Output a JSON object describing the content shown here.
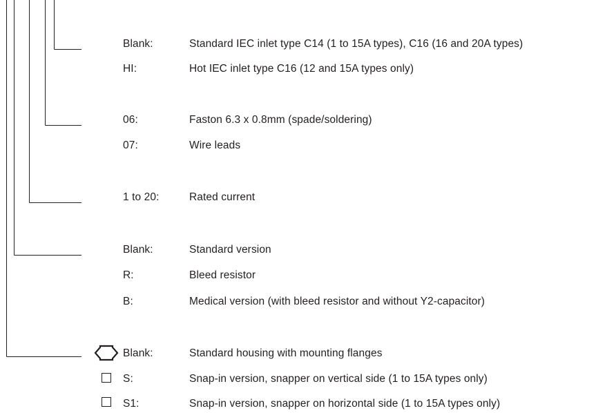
{
  "rows": [
    {
      "code": "Blank:",
      "desc": "Standard IEC inlet type C14 (1 to 15A types), C16 (16 and 20A types)"
    },
    {
      "code": "HI:",
      "desc": "Hot IEC inlet type C16 (12 and 15A types only)"
    },
    {
      "code": "06:",
      "desc": "Faston 6.3 x 0.8mm (spade/soldering)"
    },
    {
      "code": "07:",
      "desc": "Wire leads"
    },
    {
      "code": "1 to 20:",
      "desc": "Rated current"
    },
    {
      "code": "Blank:",
      "desc": "Standard version"
    },
    {
      "code": "R:",
      "desc": "Bleed resistor"
    },
    {
      "code": "B:",
      "desc": "Medical version (with bleed resistor and without Y2-capacitor)"
    },
    {
      "code": "Blank:",
      "desc": "Standard housing with mounting flanges"
    },
    {
      "code": "S:",
      "desc": "Snap-in version, snapper on vertical side (1 to 15A types only)"
    },
    {
      "code": "S1:",
      "desc": "Snap-in version, snapper on horizontal side (1 to 15A types only)"
    }
  ],
  "icons": {
    "row_9": "housing-flange-icon",
    "row_10": "snap-in-vertical-icon",
    "row_11": "snap-in-horizontal-icon"
  },
  "colors": {
    "text": "#231f20",
    "lines": "#231f20",
    "background": "#ffffff"
  }
}
